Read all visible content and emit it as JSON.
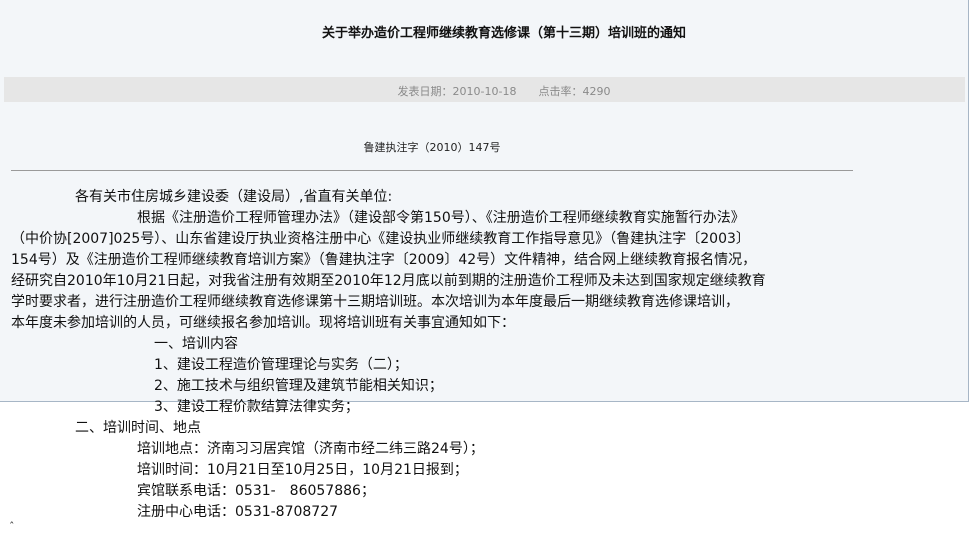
{
  "document": {
    "title": "关于举办造价工程师继续教育选修课（第十三期）培训班的通知",
    "meta": {
      "publish_label": "发表日期：",
      "publish_date": "2010-10-18",
      "clicks_label": "点击率：",
      "clicks": "4290"
    },
    "doc_number": "鲁建执注字（2010）147号",
    "body": {
      "salutation": "各有关市住房城乡建设委（建设局）,省直有关单位:",
      "para1": [
        "根据《注册造价工程师管理办法》（建设部令第150号）、《注册造价工程师继续教育实施暂行办法》",
        "（中价协[2007]025号）、山东省建设厅执业资格注册中心《建设执业师继续教育工作指导意见》（鲁建执注字〔2003〕",
        "154号）及《注册造价工程师继续教育培训方案》（鲁建执注字〔2009〕42号）文件精神，结合网上继续教育报名情况，",
        "经研究自2010年10月21日起，对我省注册有效期至2010年12月底以前到期的注册造价工程师及未达到国家规定继续教育",
        "学时要求者，进行注册造价工程师继续教育选修课第十三期培训班。本次培训为本年度最后一期继续教育选修课培训，",
        "本年度未参加培训的人员，可继续报名参加培训。现将培训班有关事宜通知如下："
      ],
      "section1_heading": "一、培训内容",
      "section1_items": [
        "1、建设工程造价管理理论与实务（二）；",
        "2、施工技术与组织管理及建筑节能相关知识；",
        "3、建设工程价款结算法律实务；"
      ],
      "section2_heading": "二、培训时间、地点",
      "section2_items": [
        "培训地点：济南习习居宾馆（济南市经二纬三路24号）；",
        "培训时间：10月21日至10月25日，10月21日报到；",
        "宾馆联系电话：0531-　86057886；",
        "注册中心电话：0531-8708727"
      ]
    }
  }
}
